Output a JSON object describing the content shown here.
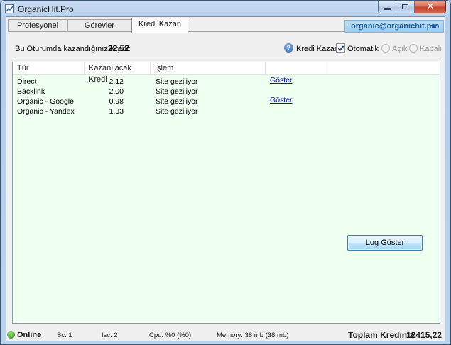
{
  "window": {
    "title": "OrganicHit.Pro",
    "close_glyph": "✕"
  },
  "tabs": [
    {
      "label": "Profesyonel",
      "active": false
    },
    {
      "label": "Görevler",
      "active": false
    },
    {
      "label": "Kredi Kazan",
      "active": true
    }
  ],
  "account": {
    "email": "organic@organichit.pro"
  },
  "session": {
    "label": "Bu Oturumda kazandığınız Kredi:",
    "value": "22,52"
  },
  "options": {
    "help_glyph": "?",
    "kredi_label": "Kredi Kazan :",
    "otomatik_label": "Otomatik",
    "otomatik_checked": true,
    "acik_label": "Açık",
    "kapali_label": "Kapalı"
  },
  "table": {
    "columns": [
      "Tür",
      "Kazanılacak Kredi",
      "İşlem",
      "",
      ""
    ],
    "rows": [
      {
        "tur": "Direct",
        "kredi": "2,12",
        "islem": "Site geziliyor",
        "link": "Göster"
      },
      {
        "tur": "Backlink",
        "kredi": "2,00",
        "islem": "Site geziliyor",
        "link": ""
      },
      {
        "tur": "Organic - Google",
        "kredi": "0,98",
        "islem": "Site geziliyor",
        "link": "Göster"
      },
      {
        "tur": "Organic - Yandex",
        "kredi": "1,33",
        "islem": "Site geziliyor",
        "link": ""
      }
    ]
  },
  "log_button": {
    "label": "Log Göster"
  },
  "status": {
    "online": "Online",
    "sc": "Sc: 1",
    "isc": "Isc: 2",
    "cpu": "Cpu: %0 (%0)",
    "memory": "Memory: 38 mb (38 mb)",
    "total_label": "Toplam Krediniz:",
    "total_value": "12415,22"
  },
  "colors": {
    "grid_background": "#effff0",
    "account_text": "#1f5b9a",
    "link": "#0000ee",
    "online": "#2e8a1a"
  }
}
